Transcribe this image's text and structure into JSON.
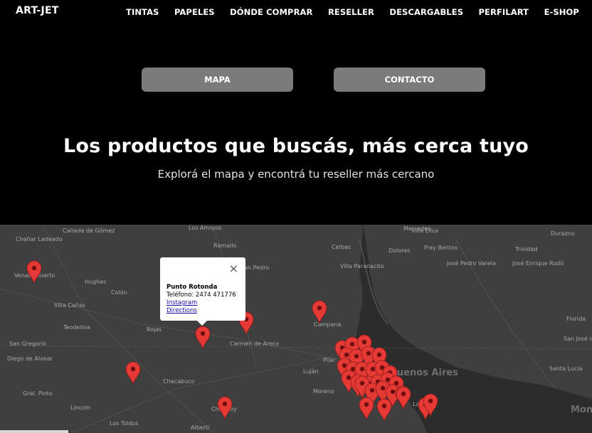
{
  "header": {
    "logo": "ART-JET",
    "nav": [
      "TINTAS",
      "PAPELES",
      "DÓNDE COMPRAR",
      "RESELLER",
      "DESCARGABLES",
      "PERFILART",
      "E-SHOP"
    ]
  },
  "buttons": {
    "mapa": "MAPA",
    "contacto": "CONTACTO"
  },
  "hero": {
    "title": "Los productos que buscás, más cerca tuyo",
    "subtitle": "Explorá el mapa y encontrá tu reseller más cercano"
  },
  "map": {
    "places": [
      "Los Arroyos",
      "Cañada de Gómez",
      "Chañar Ladeado",
      "Ramallo",
      "San Pedro",
      "Ceibas",
      "Villa Paranacito",
      "Mercedes",
      "Dolores",
      "Villa Elisa",
      "Fray Bentos",
      "José Pedro Varela",
      "Durazno",
      "Trinidad",
      "José Enrique Rodó",
      "Venado Tuerto",
      "Hughes",
      "Colón",
      "Villa Cañas",
      "Teodelina",
      "Rojas",
      "Campana",
      "Carmen de Areco",
      "San Gregorio",
      "Diego de Alvear",
      "Pilar",
      "Luján",
      "Chacabuco",
      "Gral. Pinto",
      "Lincoln",
      "Los Toldos",
      "Alberti",
      "Chivilcoy",
      "Moreno",
      "La Plata",
      "San José de Mayo",
      "Santa Lucía",
      "Florida",
      "Buenos Aires",
      "Montevideo"
    ],
    "popup": {
      "title": "Punto Rotonda",
      "phone": "Teléfono: 2474 471776",
      "link1": "Instagram",
      "link2": "Directions",
      "close": "×"
    },
    "pin_color": "#e53935"
  }
}
